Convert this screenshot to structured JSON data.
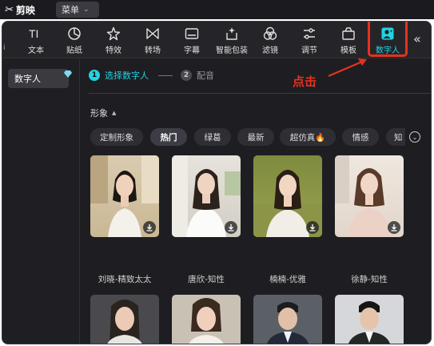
{
  "app": {
    "name": "剪映",
    "menu_label": "菜单"
  },
  "toolbar": {
    "items": [
      {
        "label": "文本",
        "icon": "text-icon"
      },
      {
        "label": "贴纸",
        "icon": "sticker-icon"
      },
      {
        "label": "特效",
        "icon": "effects-star-icon"
      },
      {
        "label": "转场",
        "icon": "transition-icon"
      },
      {
        "label": "字幕",
        "icon": "subtitle-icon"
      },
      {
        "label": "智能包装",
        "icon": "smart-package-icon"
      },
      {
        "label": "滤镜",
        "icon": "filter-icon"
      },
      {
        "label": "调节",
        "icon": "adjust-icon"
      },
      {
        "label": "模板",
        "icon": "template-icon"
      },
      {
        "label": "数字人",
        "icon": "digital-human-icon",
        "active": true
      }
    ]
  },
  "sidebar": {
    "items": [
      {
        "label": "数字人"
      }
    ]
  },
  "steps": [
    {
      "num": "1",
      "label": "选择数字人",
      "active": true
    },
    {
      "num": "2",
      "label": "配音",
      "active": false
    }
  ],
  "annotation": {
    "text": "点击",
    "color": "#e6321e"
  },
  "section": {
    "title": "形象"
  },
  "chips": [
    "定制形象",
    "热门",
    "绿葛",
    "最新",
    "超仿真🔥",
    "情感",
    "知"
  ],
  "active_chip": "热门",
  "avatars": [
    {
      "name": "刘晓-精致太太"
    },
    {
      "name": "唐欣-知性"
    },
    {
      "name": "楠楠-优雅"
    },
    {
      "name": "徐静-知性"
    }
  ],
  "colors": {
    "accent": "#22d3e0",
    "highlight": "#e6321e",
    "background": "#1e1e22"
  }
}
